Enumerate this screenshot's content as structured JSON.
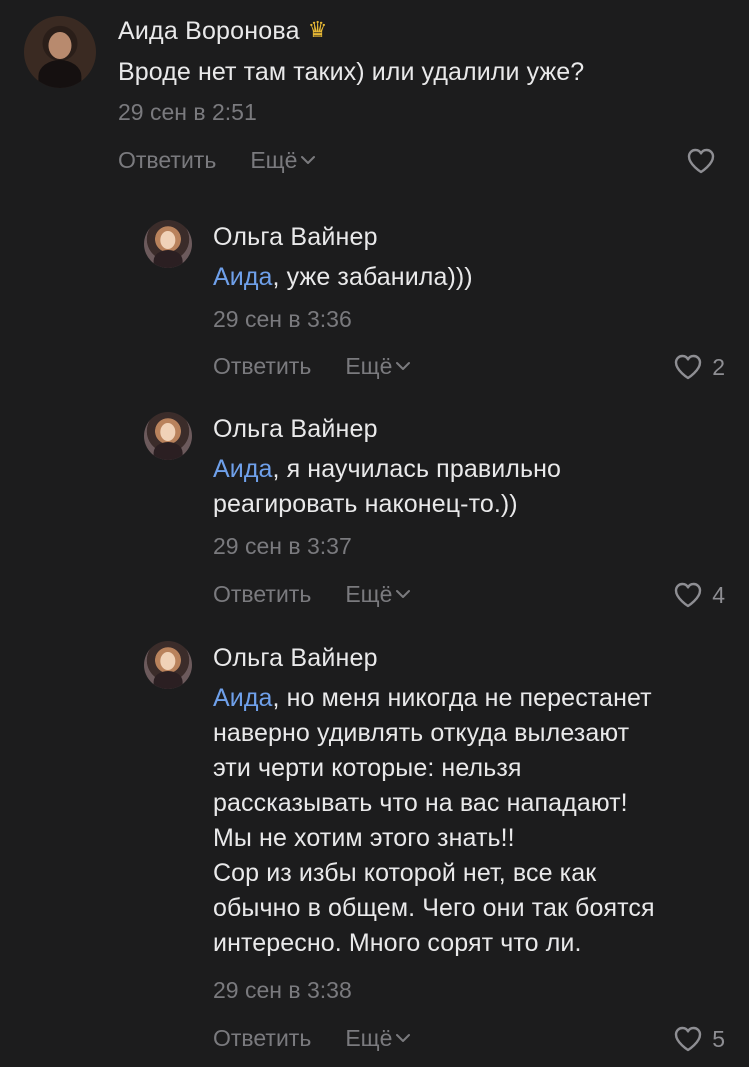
{
  "colors": {
    "background": "#1c1c1d",
    "text": "#e9e9ea",
    "secondary": "#7a7a7e",
    "mention": "#6fa0ea"
  },
  "comments": [
    {
      "author": "Аида Воронова",
      "badge_icon": "crown-icon",
      "text_lines": [
        "Вроде нет там таких) или удалили уже?"
      ],
      "time": "29 сен в 2:51",
      "reply_label": "Ответить",
      "more_label": "Ещё",
      "likes": ""
    },
    {
      "author": "Ольга Вайнер",
      "mention": "Аида",
      "text_lines": [
        ", уже забанила)))"
      ],
      "time": "29 сен в 3:36",
      "reply_label": "Ответить",
      "more_label": "Ещё",
      "likes": "2"
    },
    {
      "author": "Ольга Вайнер",
      "mention": "Аида",
      "text_lines": [
        ", я научилась правильно",
        "реагировать наконец-то.))"
      ],
      "time": "29 сен в 3:37",
      "reply_label": "Ответить",
      "more_label": "Ещё",
      "likes": "4"
    },
    {
      "author": "Ольга Вайнер",
      "mention": "Аида",
      "text_lines": [
        ", но меня никогда не перестанет",
        "наверно удивлять откуда вылезают",
        "эти черти которые: нельзя",
        "рассказывать что на вас нападают!",
        "Мы не хотим этого знать!!",
        "Сор из избы которой нет, все как",
        "обычно в общем. Чего они так боятся",
        "интересно. Много сорят что ли."
      ],
      "time": "29 сен в 3:38",
      "reply_label": "Ответить",
      "more_label": "Ещё",
      "likes": "5"
    }
  ]
}
